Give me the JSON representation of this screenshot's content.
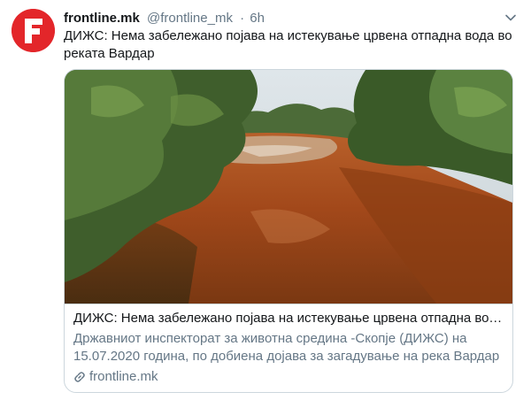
{
  "tweet": {
    "name": "frontline.mk",
    "handle": "@frontline_mk",
    "separator": "·",
    "time": "6h",
    "text": "ДИЖС: Нема забележано појава на истекување црвена отпадна вода во реката Вардар"
  },
  "avatar": {
    "letter": "F",
    "color": "#e3262a"
  },
  "card": {
    "title": "ДИЖС: Нема забележано појава на истекување црвена отпадна вод...",
    "description": "Државниот инспекторат за животна средина -Скопје (ДИЖС) на 15.07.2020 година, по добиена дојава за загадување на река Вардар ...",
    "domain": "frontline.mk"
  },
  "icons": {
    "menu": "chevron-down-icon",
    "link": "link-icon"
  },
  "colors": {
    "secondary_text": "#657786",
    "border": "#ccd6dd",
    "primary_text": "#14171a"
  }
}
